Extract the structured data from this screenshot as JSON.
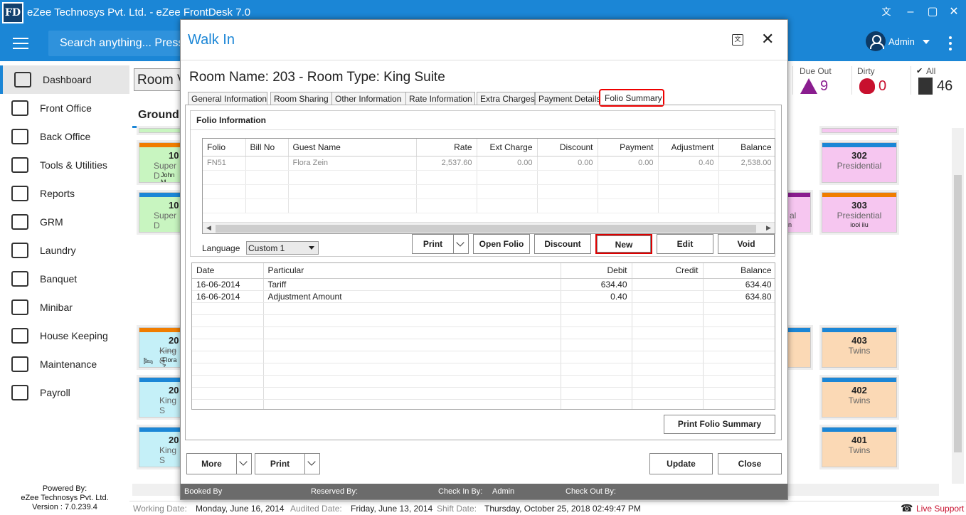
{
  "app": {
    "icon_text": "FD",
    "title": "eZee Technosys Pvt. Ltd. - eZee FrontDesk 7.0"
  },
  "header": {
    "search_placeholder": "Search anything... Press",
    "user_name": "Admin"
  },
  "sidebar": {
    "items": [
      {
        "label": "Dashboard",
        "icon": "chart-icon"
      },
      {
        "label": "Front Office",
        "icon": "front-office-icon"
      },
      {
        "label": "Back Office",
        "icon": "back-office-icon"
      },
      {
        "label": "Tools & Utilities",
        "icon": "tools-icon"
      },
      {
        "label": "Reports",
        "icon": "reports-icon"
      },
      {
        "label": "GRM",
        "icon": "grm-icon"
      },
      {
        "label": "Laundry",
        "icon": "laundry-icon"
      },
      {
        "label": "Banquet",
        "icon": "banquet-icon"
      },
      {
        "label": "Minibar",
        "icon": "minibar-icon"
      },
      {
        "label": "House Keeping",
        "icon": "housekeeping-icon"
      },
      {
        "label": "Maintenance",
        "icon": "maintenance-icon"
      },
      {
        "label": "Payroll",
        "icon": "payroll-icon"
      }
    ],
    "powered_by": "Powered By:",
    "company": "eZee Technosys Pvt. Ltd.",
    "version": "Version : 7.0.239.4"
  },
  "main": {
    "room_view_btn": "Room V",
    "floor_tab": "Ground",
    "stats": [
      {
        "label": "Due Out",
        "value": "9"
      },
      {
        "label": "Dirty",
        "value": "0"
      },
      {
        "label": "All",
        "value": "46"
      }
    ],
    "tiles_left": [
      {
        "num": "10",
        "type": "Super D",
        "guest": "John M",
        "bar": "#f07d00",
        "bg": "#c8f5c0"
      },
      {
        "num": "10",
        "type": "Super D",
        "guest": "",
        "bar": "#1b86d6",
        "bg": "#c8f5c0"
      },
      {
        "num": "20",
        "type": "King S",
        "guest": "Flora Z",
        "bar": "#f07d00",
        "bg": "#c5f0f8"
      },
      {
        "num": "20",
        "type": "King S",
        "guest": "",
        "bar": "#1b86d6",
        "bg": "#c5f0f8"
      },
      {
        "num": "20",
        "type": "King S",
        "guest": "",
        "bar": "#1b86d6",
        "bg": "#c5f0f8"
      }
    ],
    "tiles_right": [
      {
        "num": "302",
        "type": "Presidential",
        "guest": "",
        "bar": "#1b86d6",
        "bg": "#f6c6f0"
      },
      {
        "num": "303",
        "type": "Presidential",
        "guest": "iooi iiu",
        "bar": "#f07d00",
        "bg": "#f6c6f0"
      },
      {
        "num": "403",
        "type": "Twins",
        "guest": "",
        "bar": "#1b86d6",
        "bg": "#fbd9b5"
      },
      {
        "num": "402",
        "type": "Twins",
        "guest": "",
        "bar": "#1b86d6",
        "bg": "#fbd9b5"
      },
      {
        "num": "401",
        "type": "Twins",
        "guest": "",
        "bar": "#1b86d6",
        "bg": "#fbd9b5"
      }
    ],
    "partial_text": "al",
    "partial_text2": "n"
  },
  "statusbar": {
    "working_label": "Working Date:",
    "working_value": "Monday, June 16, 2014",
    "audited_label": "Audited Date:",
    "audited_value": "Friday, June 13, 2014",
    "shift_label": "Shift Date:",
    "shift_value": "Thursday, October 25, 2018 02:49:47 PM",
    "live_support": "Live Support"
  },
  "modal": {
    "title": "Walk In",
    "room_heading": "Room Name: 203 - Room Type: King Suite",
    "tabs": [
      "General Information",
      "Room Sharing",
      "Other Information",
      "Rate Information",
      "Extra Charges",
      "Payment Details",
      "Folio Summary"
    ],
    "active_tab": "Folio Summary",
    "folio_group_label": "Folio Information",
    "folio_columns": [
      "Folio",
      "Bill No",
      "Guest Name",
      "Rate",
      "Ext Charge",
      "Discount",
      "Payment",
      "Adjustment",
      "Balance"
    ],
    "folio_rows": [
      {
        "folio": "FN51",
        "bill_no": "",
        "guest": "Flora Zein",
        "rate": "2,537.60",
        "ext": "0.00",
        "discount": "0.00",
        "payment": "0.00",
        "adjustment": "0.40",
        "balance": "2,538.00"
      }
    ],
    "language_label": "Language",
    "language_value": "Custom 1",
    "buttons": {
      "print": "Print",
      "open_folio": "Open Folio",
      "discount": "Discount",
      "new": "New",
      "edit": "Edit",
      "void": "Void",
      "print_summary": "Print Folio Summary",
      "more": "More",
      "print_bottom": "Print",
      "update": "Update",
      "close": "Close"
    },
    "trans_columns": [
      "Date",
      "Particular",
      "Debit",
      "Credit",
      "Balance"
    ],
    "trans_rows": [
      {
        "date": "16-06-2014",
        "particular": "Tariff",
        "debit": "634.40",
        "credit": "",
        "balance": "634.40"
      },
      {
        "date": "16-06-2014",
        "particular": "Adjustment Amount",
        "debit": "0.40",
        "credit": "",
        "balance": "634.80"
      }
    ],
    "footer": {
      "booked_by": "Booked By",
      "reserved_by": "Reserved By:",
      "check_in_by": "Check In By:",
      "check_in_value": "Admin",
      "check_out_by": "Check Out By:"
    }
  }
}
